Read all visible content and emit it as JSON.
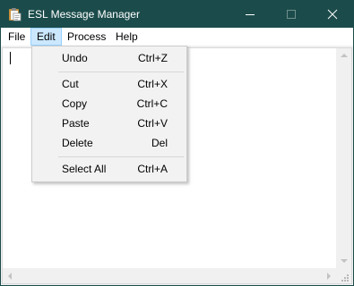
{
  "window": {
    "title": "ESL Message Manager"
  },
  "menubar": {
    "items": [
      {
        "label": "File"
      },
      {
        "label": "Edit"
      },
      {
        "label": "Process"
      },
      {
        "label": "Help"
      }
    ],
    "active": "Edit"
  },
  "edit_menu": {
    "items": [
      {
        "label": "Undo",
        "shortcut": "Ctrl+Z"
      },
      {
        "label": "Cut",
        "shortcut": "Ctrl+X"
      },
      {
        "label": "Copy",
        "shortcut": "Ctrl+C"
      },
      {
        "label": "Paste",
        "shortcut": "Ctrl+V"
      },
      {
        "label": "Delete",
        "shortcut": "Del"
      },
      {
        "label": "Select All",
        "shortcut": "Ctrl+A"
      }
    ]
  },
  "editor": {
    "text": ""
  },
  "colors": {
    "titlebar": "#1b4c4b",
    "menu_highlight": "#cce8ff",
    "menu_highlight_border": "#99d1ff",
    "dropdown_bg": "#f2f2f2"
  },
  "icons": {
    "app": "clipboard-icon",
    "minimize": "minimize-icon",
    "maximize": "maximize-icon",
    "close": "close-icon"
  }
}
